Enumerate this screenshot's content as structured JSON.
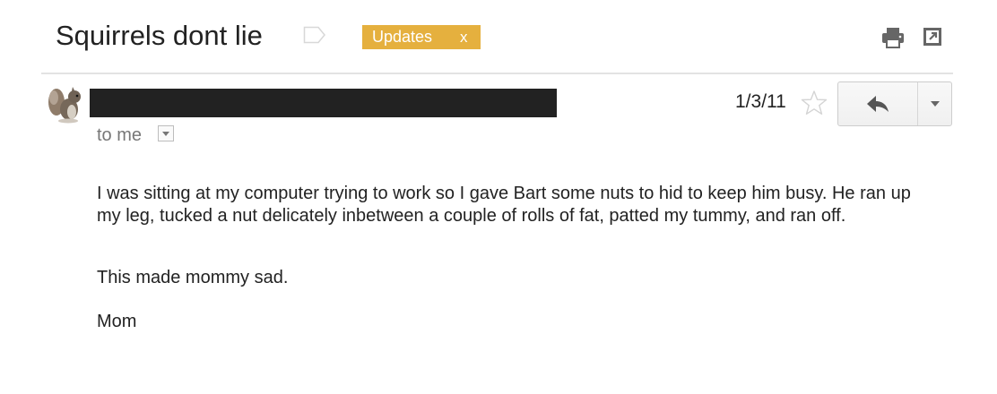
{
  "message": {
    "subject": "Squirrels dont lie",
    "label": {
      "name": "Updates",
      "remove": "x",
      "color": "#e5b03e"
    },
    "toolbar": {
      "print_icon": "print-icon",
      "new_window_icon": "new-window-icon"
    },
    "sender": {
      "avatar": "squirrel-avatar",
      "name_redacted": true
    },
    "recipient": "to me",
    "date": "1/3/11",
    "starred": false,
    "actions": {
      "reply_icon": "reply-icon",
      "more_icon": "chevron-down-icon"
    },
    "body": {
      "paragraphs": [
        "I was sitting at my computer trying to work so I gave Bart some nuts to hid to keep him busy.  He ran up my leg, tucked a nut delicately inbetween a couple of rolls of fat, patted my tummy, and ran off.",
        "This made mommy sad.",
        "Mom"
      ]
    }
  }
}
